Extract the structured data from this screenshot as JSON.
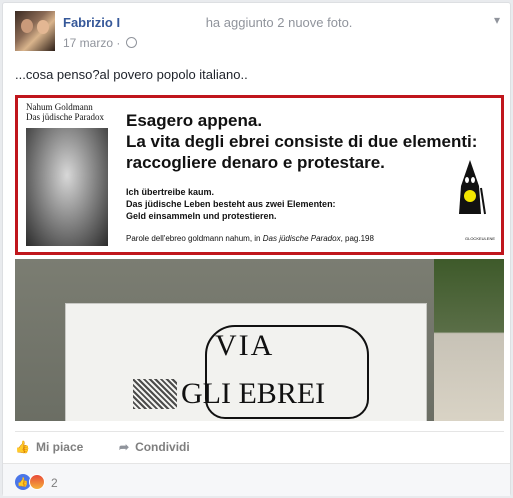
{
  "post": {
    "author": "Fabrizio I",
    "action": "ha aggiunto 2 nuove foto.",
    "date": "17 marzo",
    "separator": "·",
    "text": "...cosa penso?al povero popolo italiano.."
  },
  "image1": {
    "book_author": "Nahum Goldmann",
    "book_title": "Das jüdische Paradox",
    "headline_1": "Esagero appena.",
    "headline_2": "La vita degli ebrei consiste di due elementi:",
    "headline_3": "raccogliere denaro e protestare.",
    "german_1": "Ich übertreibe kaum.",
    "german_2": "Das jüdische Leben besteht aus zwei Elementen:",
    "german_3": "Geld einsammeln und protestieren.",
    "quote_prefix": "Parole dell'ebreo goldmann nahum, in",
    "quote_title": "Das jüdische Paradox",
    "quote_page": ", pag.198",
    "figure_caption": "GLOCKEULENE"
  },
  "image2": {
    "sign_line1": "VIA",
    "sign_line2": "GLI EBREI"
  },
  "actions": {
    "like_label": "Mi piace",
    "share_label": "Condividi"
  },
  "reactions": {
    "count": "2"
  },
  "colors": {
    "link": "#365899",
    "frame": "#c0161c"
  }
}
